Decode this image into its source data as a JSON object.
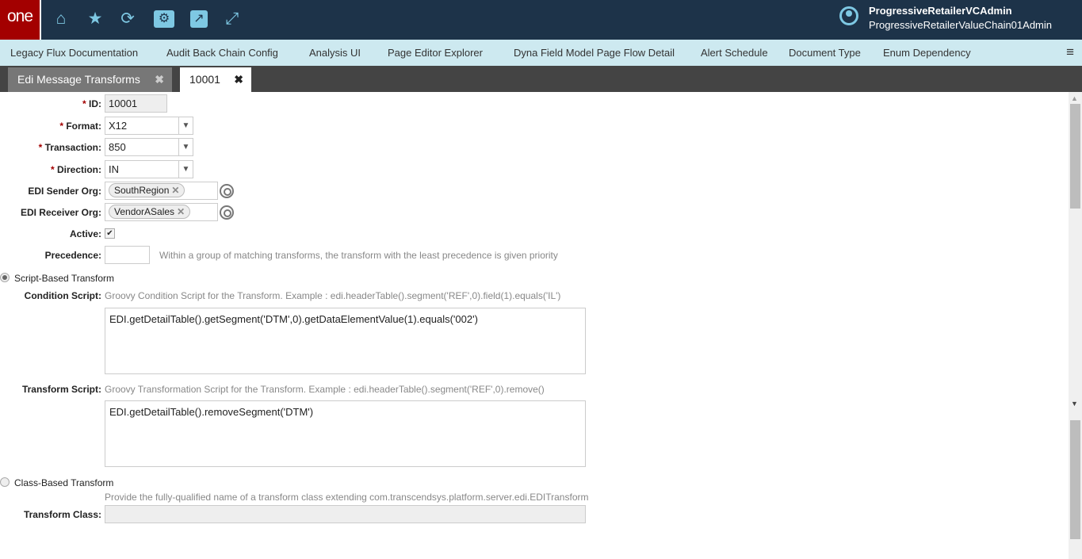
{
  "header": {
    "logo": "one",
    "icons": [
      "home-icon",
      "star-icon",
      "refresh-icon",
      "folder-gear-icon",
      "external-link-icon",
      "expand-icon"
    ],
    "user_name": "ProgressiveRetailerVCAdmin",
    "user_org": "ProgressiveRetailerValueChain01Admin"
  },
  "nav": {
    "items": [
      "Legacy Flux Documentation",
      "Audit Back Chain Config",
      "Analysis UI",
      "Page Editor Explorer",
      "Dyna Field Model Page Flow Detail",
      "Alert Schedule",
      "Document Type",
      "Enum Dependency"
    ]
  },
  "tabs": [
    {
      "label": "Edi Message Transforms",
      "active": false
    },
    {
      "label": "10001",
      "active": true
    }
  ],
  "form": {
    "id": {
      "label": "ID:",
      "value": "10001"
    },
    "format": {
      "label": "Format:",
      "value": "X12"
    },
    "transaction": {
      "label": "Transaction:",
      "value": "850"
    },
    "direction": {
      "label": "Direction:",
      "value": "IN"
    },
    "sender": {
      "label": "EDI Sender Org:",
      "value": "SouthRegion"
    },
    "receiver": {
      "label": "EDI Receiver Org:",
      "value": "VendorASales"
    },
    "active": {
      "label": "Active:",
      "checked": true,
      "mark": "✔"
    },
    "precedence": {
      "label": "Precedence:",
      "value": "",
      "hint": "Within a group of matching transforms, the transform with the least precedence is given priority"
    },
    "script_radio": {
      "label": "Script-Based Transform",
      "selected": true
    },
    "condition": {
      "label": "Condition Script:",
      "hint": "Groovy Condition Script for the Transform. Example : edi.headerTable().segment('REF',0).field(1).equals('IL')",
      "value": "EDI.getDetailTable().getSegment('DTM',0).getDataElementValue(1).equals('002')"
    },
    "transform": {
      "label": "Transform Script:",
      "hint": "Groovy Transformation Script for the Transform. Example : edi.headerTable().segment('REF',0).remove()",
      "value": "EDI.getDetailTable().removeSegment('DTM')"
    },
    "class_radio": {
      "label": "Class-Based Transform",
      "selected": false
    },
    "class_hint": "Provide the fully-qualified name of a transform class extending com.transcendsys.platform.server.edi.EDITransform",
    "transform_class": {
      "label": "Transform Class:",
      "value": ""
    }
  }
}
